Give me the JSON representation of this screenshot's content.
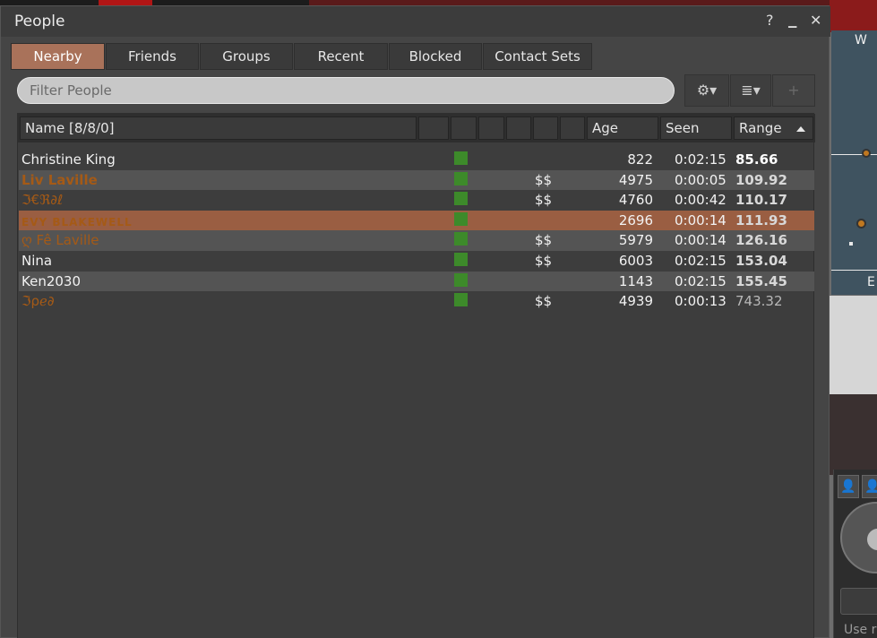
{
  "window": {
    "title": "People",
    "help_icon": "?",
    "minimize_icon": "▁",
    "close_icon": "✕"
  },
  "tabs": [
    {
      "label": "Nearby",
      "active": true
    },
    {
      "label": "Friends",
      "active": false
    },
    {
      "label": "Groups",
      "active": false
    },
    {
      "label": "Recent",
      "active": false
    },
    {
      "label": "Blocked",
      "active": false
    },
    {
      "label": "Contact Sets",
      "active": false
    }
  ],
  "filter": {
    "placeholder": "Filter People",
    "value": ""
  },
  "toolbar": {
    "gear_icon": "gear-icon",
    "gear_glyph": "⚙▾",
    "view_icon": "list-view-icon",
    "view_glyph": "≣▾",
    "add_glyph": "+"
  },
  "list": {
    "columns": {
      "name": "Name [8/8/0]",
      "age": "Age",
      "seen": "Seen",
      "range": "Range"
    },
    "rows": [
      {
        "name": "Christine King",
        "style": "normal",
        "pay": "",
        "age": "822",
        "seen": "0:02:15",
        "range": "85.66",
        "range_style": "lit"
      },
      {
        "name": "Liv Laville",
        "style": "orange-bold",
        "pay": "$$",
        "age": "4975",
        "seen": "0:00:05",
        "range": "109.92",
        "range_style": "mid"
      },
      {
        "name": "ℑ€ℜ∂ℓ",
        "style": "orange",
        "pay": "$$",
        "age": "4760",
        "seen": "0:00:42",
        "range": "110.17",
        "range_style": "mid"
      },
      {
        "name": "EVY BLAKEWELL",
        "style": "orange-caps",
        "pay": "",
        "age": "2696",
        "seen": "0:00:14",
        "range": "111.93",
        "range_style": "mid"
      },
      {
        "name": "ღ Fê Laville",
        "style": "orange",
        "pay": "$$",
        "age": "5979",
        "seen": "0:00:14",
        "range": "126.16",
        "range_style": "mid"
      },
      {
        "name": "Nina",
        "style": "normal",
        "pay": "$$",
        "age": "6003",
        "seen": "0:02:15",
        "range": "153.04",
        "range_style": "mid"
      },
      {
        "name": "Ken2030",
        "style": "normal",
        "pay": "",
        "age": "1143",
        "seen": "0:02:15",
        "range": "155.45",
        "range_style": "mid"
      },
      {
        "name": "ℑρℯ∂",
        "style": "orange",
        "pay": "$$",
        "age": "4939",
        "seen": "0:00:13",
        "range": "743.32",
        "range_style": "dim"
      }
    ]
  },
  "background": {
    "compass_w": "W",
    "compass_e": "E",
    "panel_text": "Use r"
  },
  "colors": {
    "active_tab": "#a9725a",
    "selected_row": "#9a5e42",
    "status_green": "#3d8a2a",
    "name_orange": "#a55a16"
  }
}
